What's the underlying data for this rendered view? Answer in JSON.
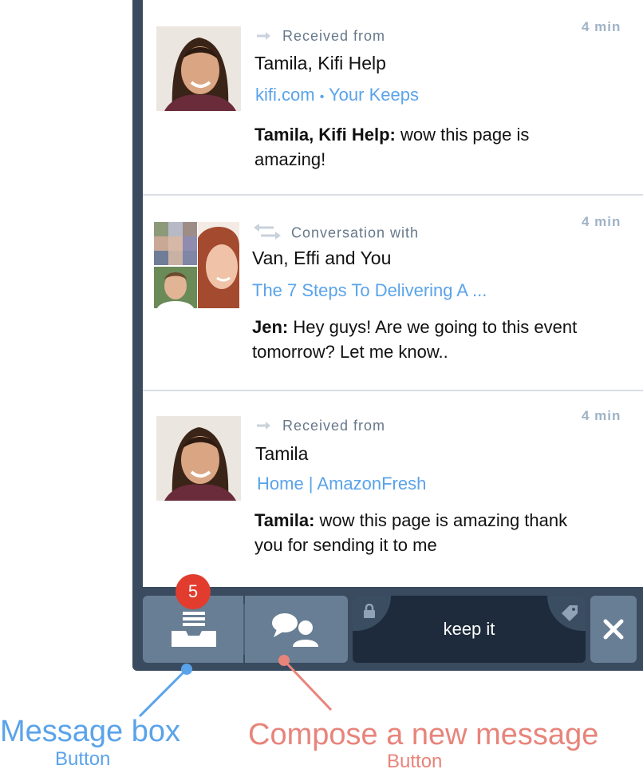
{
  "messages": [
    {
      "direction": "Received from",
      "participants": "Tamila, Kifi Help",
      "link_parts": [
        "kifi.com",
        "•",
        "Your Keeps"
      ],
      "time": "4 min",
      "sender": "Tamila, Kifi Help:",
      "text": " wow this page is amazing!"
    },
    {
      "direction": "Conversation with",
      "participants": "Van, Effi and You",
      "link": "The 7 Steps To Delivering A ...",
      "time": "4 min",
      "sender": "Jen:",
      "text": " Hey guys! Are we going to this event tomorrow? Let me know.."
    },
    {
      "direction": "Received from",
      "participants": "Tamila",
      "link": "Home | AmazonFresh",
      "time": "4 min",
      "sender": "Tamila:",
      "text": " wow this page is amazing thank you for sending it to me"
    }
  ],
  "bottom_bar": {
    "badge_count": "5",
    "keep_label": "keep it"
  },
  "annotations": {
    "message_box": {
      "title": "Message box",
      "subtitle": "Button",
      "color": "#5aa3ea"
    },
    "compose": {
      "title": "Compose a new message",
      "subtitle": "Button",
      "color": "#e8847b"
    }
  },
  "icons": {
    "received": "arrow-right-icon",
    "conversation": "two-way-arrows-icon",
    "inbox": "inbox-icon",
    "compose": "people-chat-icon",
    "lock": "lock-icon",
    "tag": "tag-icon",
    "close": "close-icon"
  }
}
